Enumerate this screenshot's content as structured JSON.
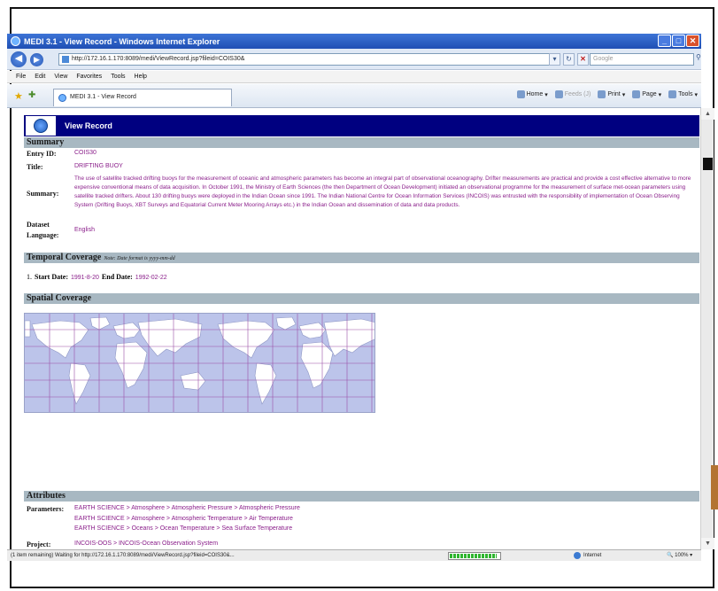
{
  "window": {
    "title": "MEDI 3.1 - View Record - Windows Internet Explorer",
    "minimize": "_",
    "maximize": "□",
    "close": "✕"
  },
  "address": {
    "url": "http://172.16.1.170:8089/medi/ViewRecord.jsp?fileid=COIS30&",
    "search_placeholder": "Google",
    "back": "◀",
    "forward": "▶"
  },
  "menu": [
    "File",
    "Edit",
    "View",
    "Favorites",
    "Tools",
    "Help"
  ],
  "tab": {
    "label": "MEDI 3.1 - View Record"
  },
  "commands": [
    {
      "label": "Home",
      "disabled": false
    },
    {
      "label": "Feeds (J)",
      "disabled": true
    },
    {
      "label": "Print",
      "disabled": false
    },
    {
      "label": "Page",
      "disabled": false
    },
    {
      "label": "Tools",
      "disabled": false
    }
  ],
  "page": {
    "header": "View Record",
    "summary": {
      "section": "Summary",
      "entry_id_label": "Entry ID:",
      "entry_id": "COIS30",
      "title_label": "Title:",
      "title": "DRIFTING BUOY",
      "summary_label": "Summary:",
      "summary_text": "The use of satellite tracked drifting buoys for the measurement of oceanic and atmospheric parameters has become an integral part of observational oceanography. Drifter measurements are practical and provide a cost effective alternative to more expensive conventional means of data acquisition. In October 1991, the Ministry of Earth Sciences (the then Department of Ocean Development) initiated an observational programme for the measurement of surface met-ocean parameters using satellite tracked drifters. About 130 drifting buoys were deployed in the Indian Ocean since 1991. The Indian National Centre for Ocean Information Services (INCOIS) was entrusted with the responsibility of implementation of Ocean Observing System (Drifting Buoys, XBT Surveys and Equatorial Current Meter Mooring Arrays etc.) in the Indian Ocean and dissemination of data and data products.",
      "dataset_label_1": "Dataset",
      "dataset_label_2": "Language:",
      "dataset_language": "English"
    },
    "temporal": {
      "section": "Temporal Coverage",
      "note": "Note: Date format is yyyy-mm-dd",
      "index": "1.",
      "start_label": "Start Date:",
      "start": "1991-8-20",
      "end_label": "End Date:",
      "end": "1992-02-22"
    },
    "spatial": {
      "section": "Spatial Coverage"
    },
    "attributes": {
      "section": "Attributes",
      "parameters_label": "Parameters:",
      "parameters": [
        "EARTH SCIENCE > Atmosphere > Atmospheric Pressure > Atmospheric Pressure",
        "EARTH SCIENCE > Atmosphere > Atmospheric Temperature > Air Temperature",
        "EARTH SCIENCE > Oceans > Ocean Temperature > Sea Surface Temperature"
      ],
      "project_label": "Project:",
      "project": "INCOIS-OOS > INCOIS-Ocean Observation System"
    }
  },
  "status": {
    "text": "(1 item remaining) Waiting for http://172.16.1.170:8089/medi/ViewRecord.jsp?fileid=COIS30&...",
    "progress": 0.95,
    "zone": "Internet",
    "zoom": "100%"
  }
}
